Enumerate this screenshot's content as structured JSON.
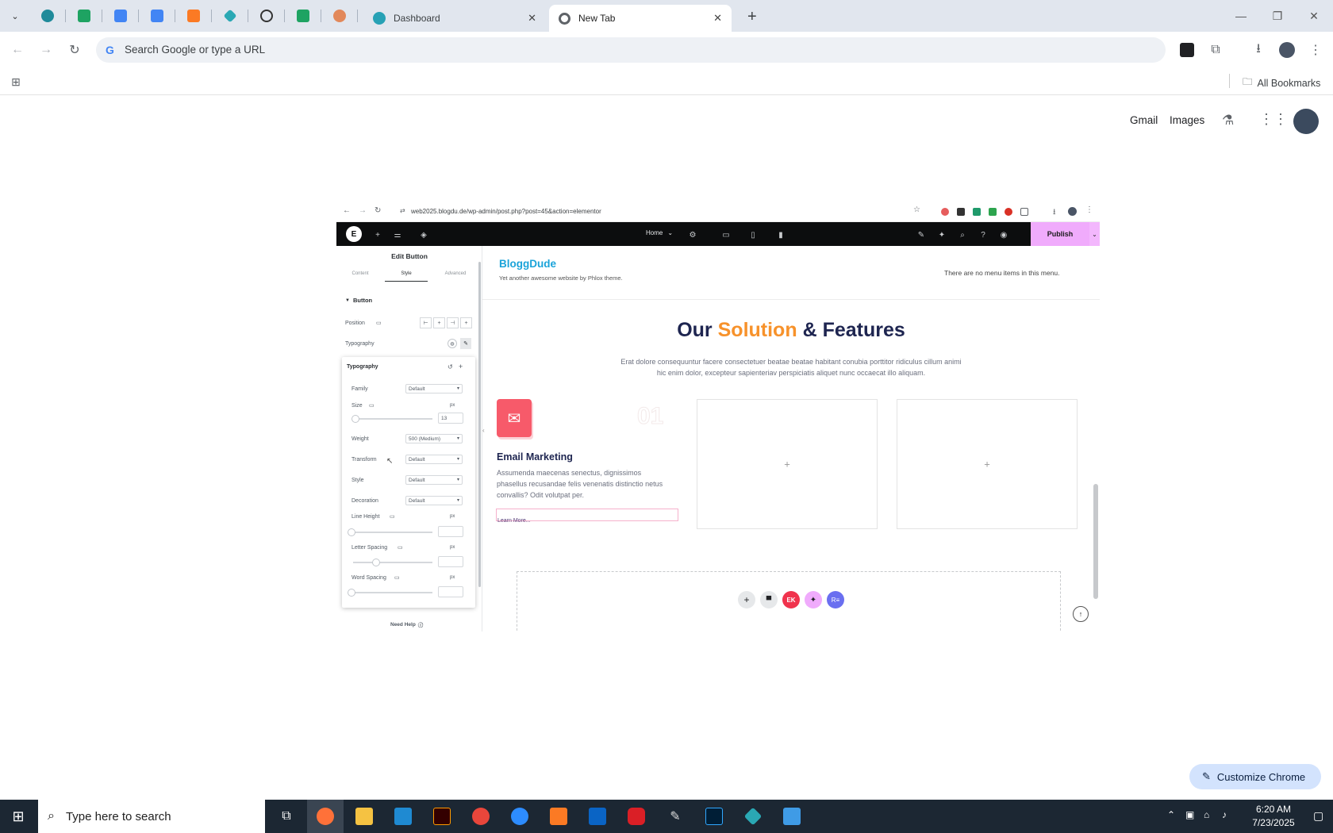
{
  "browser": {
    "tabs": [
      {
        "label": "Dashboard",
        "icon": "globe-teal"
      },
      {
        "label": "New Tab",
        "icon": "chrome"
      }
    ],
    "pinned_tabs": [
      "shield-icon",
      "sheets-icon",
      "docs-icon",
      "docs-icon",
      "xampp-icon",
      "gemini-icon",
      "openai-icon",
      "sheets-icon",
      "claude-icon"
    ],
    "omnibox_placeholder": "Search Google or type a URL",
    "bookmarks_label": "All Bookmarks",
    "tab_close": "✕",
    "new_tab": "+"
  },
  "ntp": {
    "links": [
      "Gmail",
      "Images"
    ],
    "customize_label": "Customize Chrome"
  },
  "inner": {
    "url": "web2025.blogdu.de/wp-admin/post.php?post=45&action=elementor",
    "page_select": "Home",
    "publish": "Publish",
    "panel": {
      "title": "Edit Button",
      "tabs": [
        "Content",
        "Style",
        "Advanced"
      ],
      "section": "Button",
      "position_label": "Position",
      "typography_label": "Typography",
      "popover_title": "Typography",
      "family_label": "Family",
      "family_value": "Default",
      "size_label": "Size",
      "size_unit": "px",
      "size_value": "13",
      "weight_label": "Weight",
      "weight_value": "500 (Medium)",
      "transform_label": "Transform",
      "transform_value": "Default",
      "style_label": "Style",
      "style_value": "Default",
      "decoration_label": "Decoration",
      "decoration_value": "Default",
      "line_height_label": "Line Height",
      "letter_spacing_label": "Letter Spacing",
      "word_spacing_label": "Word Spacing",
      "unit": "px",
      "need_help": "Need Help"
    },
    "site": {
      "name": "BloggDude",
      "tagline": "Yet another awesome website by Phlox theme.",
      "menu_note": "There are no menu items in this menu.",
      "heading_1": "Our",
      "heading_2": "Solution",
      "heading_3": "& Features",
      "description": "Erat dolore consequuntur facere consectetuer beatae beatae habitant conubia porttitor ridiculus cillum animi hic enim dolor, excepteur sapienteriav perspiciatis aliquet nunc occaecat illo aliquam.",
      "card_number": "01",
      "card_title": "Email Marketing",
      "card_text": "Assumenda maecenas senectus, dignissimos phasellus recusandae felis venenatis distinctio netus convallis? Odit volutpat per.",
      "card_link": "Learn More..."
    }
  },
  "taskbar": {
    "search_placeholder": "Type here to search",
    "time": "6:20 AM",
    "date": "7/23/2025"
  },
  "colors": {
    "accent_orange": "#f7922b",
    "heading_dark": "#1e2550",
    "brand_blue": "#1aa3d9",
    "publish_pink": "#f0abfc",
    "icon_red": "#f75a6a"
  }
}
